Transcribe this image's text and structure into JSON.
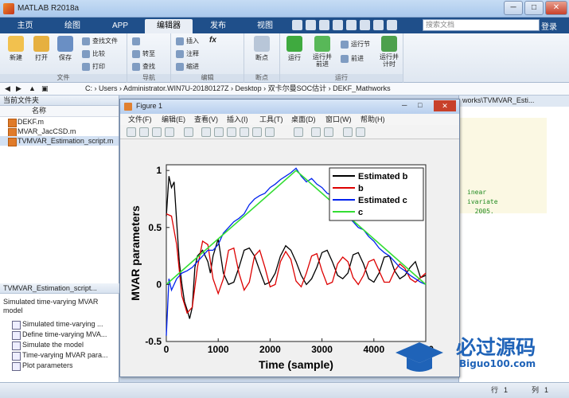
{
  "window": {
    "title": "MATLAB R2018a",
    "minimize": "─",
    "maximize": "□",
    "close": "✕"
  },
  "tabs": [
    {
      "label": "主页",
      "active": false
    },
    {
      "label": "绘图",
      "active": false
    },
    {
      "label": "APP",
      "active": false
    },
    {
      "label": "编辑器",
      "active": true
    },
    {
      "label": "发布",
      "active": false
    },
    {
      "label": "视图",
      "active": false
    }
  ],
  "search": {
    "placeholder": "搜索文档"
  },
  "login_label": "登录",
  "ribbon": {
    "file_group": {
      "label": "文件",
      "new": "新建",
      "open": "打开",
      "save": "保存",
      "find_files": "查找文件",
      "compare": "比较",
      "print": "打印"
    },
    "nav_group": {
      "label": "导航",
      "goto": "转至",
      "find": "查找"
    },
    "edit_group": {
      "label": "编辑",
      "insert": "插入",
      "comment": "注释",
      "indent": "缩进",
      "fx": "fx"
    },
    "breakpoint_group": {
      "label": "断点",
      "breakpoints": "断点"
    },
    "run_group": {
      "label": "运行",
      "run": "运行",
      "run_advance": "运行并\n前进",
      "run_section": "运行节",
      "advance": "前进",
      "run_time": "运行并\n计时"
    }
  },
  "address": {
    "path": "C: › Users › Administrator.WIN7U-20180127Z › Desktop › 双卡尔曼SOC估计 › DEKF_Mathworks"
  },
  "current_folder": {
    "title": "当前文件夹",
    "column": "名称",
    "files": [
      {
        "name": "DEKF.m",
        "selected": false
      },
      {
        "name": "MVAR_JacCSD.m",
        "selected": false
      },
      {
        "name": "TVMVAR_Estimation_script.m",
        "selected": true
      }
    ]
  },
  "details": {
    "header": "TVMVAR_Estimation_script...",
    "description": "Simulated time-varying MVAR model",
    "functions": [
      "Simulated time-varying ...",
      "Define time-varying MVA...",
      "Simulate the model",
      "Time-varying MVAR para...",
      "Plot parameters"
    ]
  },
  "editor": {
    "tab": "works\\TVMVAR_Esti...",
    "code_lines": [
      "inear",
      "ivariate",
      "  2005."
    ]
  },
  "status": {
    "row_label": "行",
    "row": "1",
    "col_label": "列",
    "col": "1"
  },
  "figure": {
    "title": "Figure 1",
    "menu": [
      "文件(F)",
      "编辑(E)",
      "查看(V)",
      "插入(I)",
      "工具(T)",
      "桌面(D)",
      "窗口(W)",
      "帮助(H)"
    ]
  },
  "chart_data": {
    "type": "line",
    "title": "",
    "xlabel": "Time (sample)",
    "ylabel": "MVAR parameters",
    "xlim": [
      0,
      5000
    ],
    "ylim": [
      -0.5,
      1.05
    ],
    "xticks": [
      0,
      1000,
      2000,
      3000,
      4000,
      5000
    ],
    "yticks": [
      -0.5,
      0,
      0.5,
      1
    ],
    "xtick_labels": [
      "0",
      "1000",
      "2000",
      "3000",
      "4000",
      "500"
    ],
    "ytick_labels": [
      "-0.5",
      "0",
      "0.5",
      "1"
    ],
    "legend_position": "top-right",
    "grid": false,
    "series": [
      {
        "name": "Estimated b",
        "color": "#000000",
        "x": [
          0,
          50,
          100,
          150,
          200,
          250,
          300,
          350,
          400,
          450,
          500,
          550,
          600,
          700,
          800,
          850,
          900,
          1000,
          1100,
          1200,
          1300,
          1400,
          1500,
          1600,
          1700,
          1800,
          1900,
          2000,
          2100,
          2200,
          2300,
          2400,
          2500,
          2600,
          2700,
          2800,
          2900,
          3000,
          3100,
          3200,
          3300,
          3400,
          3500,
          3600,
          3700,
          3800,
          3900,
          4000,
          4100,
          4200,
          4300,
          4400,
          4500,
          4600,
          4700,
          4800,
          4900,
          5000
        ],
        "y": [
          0.6,
          0.95,
          0.85,
          0.9,
          0.55,
          0.2,
          0.0,
          -0.15,
          -0.22,
          -0.3,
          -0.2,
          0.15,
          0.25,
          0.3,
          0.2,
          0.1,
          0.25,
          0.4,
          0.1,
          0.0,
          0.02,
          0.15,
          0.3,
          0.32,
          0.25,
          0.12,
          0.0,
          0.02,
          0.1,
          0.25,
          0.34,
          0.3,
          0.2,
          0.08,
          0.0,
          0.05,
          0.15,
          0.28,
          0.3,
          0.2,
          0.08,
          0.05,
          0.1,
          0.26,
          0.28,
          0.18,
          0.05,
          0.02,
          0.1,
          0.24,
          0.25,
          0.12,
          0.05,
          0.08,
          0.15,
          0.2,
          0.06,
          0.08
        ]
      },
      {
        "name": "b",
        "color": "#dd0000",
        "x": [
          0,
          100,
          200,
          300,
          400,
          500,
          600,
          700,
          800,
          900,
          1000,
          1100,
          1200,
          1300,
          1400,
          1500,
          1600,
          1700,
          1800,
          1900,
          2000,
          2100,
          2200,
          2300,
          2400,
          2500,
          2600,
          2700,
          2800,
          2900,
          3000,
          3100,
          3200,
          3300,
          3400,
          3500,
          3600,
          3700,
          3800,
          3900,
          4000,
          4100,
          4200,
          4300,
          4400,
          4500,
          4600,
          4700,
          4800,
          4900,
          5000
        ],
        "y": [
          0.62,
          0.6,
          0.35,
          -0.1,
          -0.25,
          -0.2,
          0.15,
          0.38,
          0.35,
          0.05,
          -0.08,
          0.05,
          0.3,
          0.32,
          0.1,
          -0.05,
          0.02,
          0.25,
          0.3,
          0.15,
          -0.02,
          0.0,
          0.2,
          0.29,
          0.22,
          0.03,
          -0.02,
          0.1,
          0.25,
          0.27,
          0.12,
          0.0,
          0.02,
          0.18,
          0.24,
          0.2,
          0.06,
          0.0,
          0.08,
          0.2,
          0.22,
          0.12,
          0.02,
          0.02,
          0.12,
          0.18,
          0.14,
          0.05,
          0.02,
          0.06,
          0.1
        ]
      },
      {
        "name": "Estimated c",
        "color": "#0022ee",
        "x": [
          0,
          50,
          100,
          200,
          300,
          400,
          500,
          600,
          700,
          800,
          900,
          1000,
          1100,
          1200,
          1300,
          1400,
          1500,
          1600,
          1700,
          1800,
          1900,
          2000,
          2100,
          2200,
          2300,
          2400,
          2500,
          2600,
          2700,
          2800,
          2900,
          3000,
          3100,
          3200,
          3300,
          3400,
          3500,
          3600,
          3700,
          3800,
          3900,
          4000,
          4100,
          4200,
          4300,
          4400,
          4500,
          4600,
          4700,
          4800,
          4900,
          5000
        ],
        "y": [
          -0.45,
          0.05,
          -0.05,
          0.05,
          0.1,
          0.12,
          0.15,
          0.2,
          0.25,
          0.3,
          0.3,
          0.35,
          0.45,
          0.5,
          0.55,
          0.58,
          0.62,
          0.7,
          0.75,
          0.78,
          0.8,
          0.85,
          0.88,
          0.92,
          0.95,
          0.98,
          1.02,
          0.95,
          0.9,
          0.93,
          0.88,
          0.85,
          0.8,
          0.78,
          0.72,
          0.68,
          0.6,
          0.55,
          0.5,
          0.48,
          0.42,
          0.38,
          0.32,
          0.28,
          0.25,
          0.2,
          0.15,
          0.12,
          0.08,
          0.05,
          0.02,
          0.0
        ]
      },
      {
        "name": "c",
        "color": "#33dd33",
        "x": [
          0,
          2500,
          5000
        ],
        "y": [
          0.0,
          1.0,
          0.0
        ]
      }
    ]
  }
}
